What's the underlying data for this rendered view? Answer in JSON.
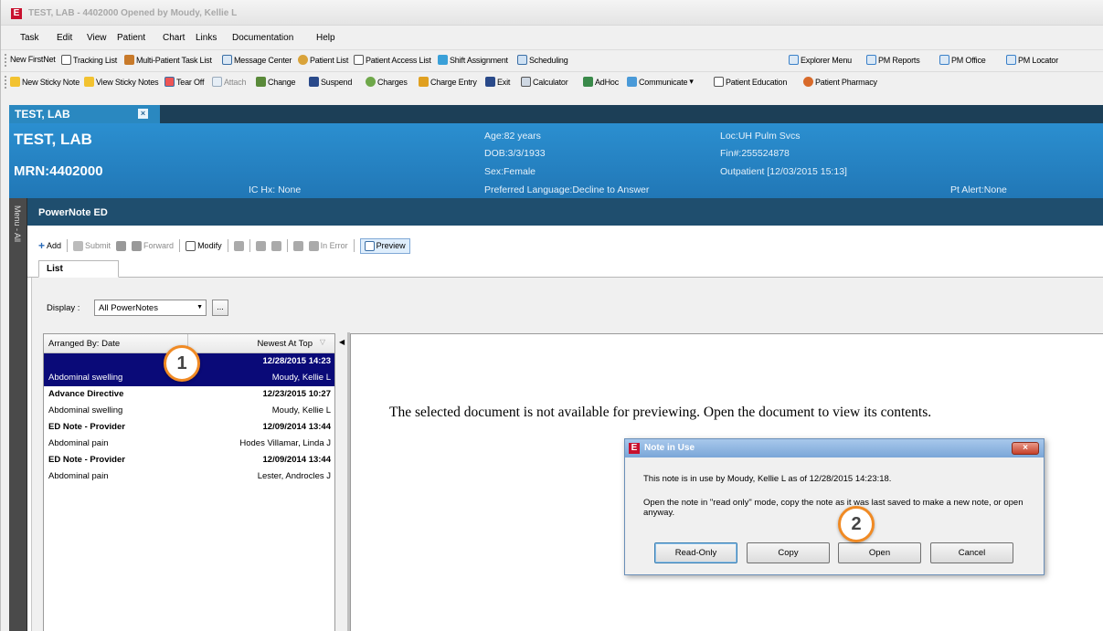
{
  "window": {
    "title": "TEST, LAB - 4402000 Opened by Moudy, Kellie L",
    "logo": "E"
  },
  "menu": [
    "Task",
    "Edit",
    "View",
    "Patient",
    "Chart",
    "Links",
    "Documentation",
    "Help"
  ],
  "toolbar1": [
    {
      "label": "New FirstNet",
      "icon": "none"
    },
    {
      "label": "Tracking List",
      "icon": "tracking-list-icon"
    },
    {
      "label": "Multi-Patient Task List",
      "icon": "multi-patient-icon"
    },
    {
      "label": "Message Center",
      "icon": "message-center-icon"
    },
    {
      "label": "Patient List",
      "icon": "patient-list-icon"
    },
    {
      "label": "Patient Access List",
      "icon": "patient-access-icon"
    },
    {
      "label": "Shift Assignment",
      "icon": "shift-assignment-icon"
    },
    {
      "label": "Scheduling",
      "icon": "scheduling-icon"
    },
    {
      "label": "Explorer Menu",
      "icon": "explorer-menu-icon"
    },
    {
      "label": "PM Reports",
      "icon": "pm-reports-icon"
    },
    {
      "label": "PM Office",
      "icon": "pm-office-icon"
    },
    {
      "label": "PM Locator",
      "icon": "pm-locator-icon"
    }
  ],
  "toolbar2": [
    {
      "label": "New Sticky Note",
      "icon": "sticky-note-icon"
    },
    {
      "label": "View Sticky Notes",
      "icon": "view-sticky-notes-icon"
    },
    {
      "label": "Tear Off",
      "icon": "tear-off-icon"
    },
    {
      "label": "Attach",
      "icon": "attach-icon"
    },
    {
      "label": "Change",
      "icon": "change-icon"
    },
    {
      "label": "Suspend",
      "icon": "suspend-icon"
    },
    {
      "label": "Charges",
      "icon": "charges-icon"
    },
    {
      "label": "Charge Entry",
      "icon": "charge-entry-icon"
    },
    {
      "label": "Exit",
      "icon": "exit-icon"
    },
    {
      "label": "Calculator",
      "icon": "calculator-icon"
    },
    {
      "label": "AdHoc",
      "icon": "adhoc-icon"
    },
    {
      "label": "Communicate",
      "icon": "communicate-icon"
    },
    {
      "label": "Patient Education",
      "icon": "patient-education-icon"
    },
    {
      "label": "Patient Pharmacy",
      "icon": "patient-pharmacy-icon"
    }
  ],
  "patient_tab": {
    "label": "TEST, LAB",
    "close": "×"
  },
  "banner": {
    "name": "TEST, LAB",
    "mrn": "MRN:4402000",
    "ic_hx": "IC Hx: None",
    "age": "Age:82 years",
    "dob": "DOB:3/3/1933",
    "sex": "Sex:Female",
    "language": "Preferred Language:Decline to Answer",
    "loc": "Loc:UH Pulm Svcs",
    "fin": "Fin#:255524878",
    "encounter": "Outpatient [12/03/2015 15:13]",
    "alert": "Pt Alert:None"
  },
  "side_menu": "Menu - All",
  "section_title": "PowerNote ED",
  "actions": {
    "add": "Add",
    "submit": "Submit",
    "forward": "Forward",
    "modify": "Modify",
    "in_error": "In Error",
    "preview": "Preview"
  },
  "list_tab": "List",
  "display": {
    "label": "Display :",
    "value": "All PowerNotes",
    "ellipsis": "..."
  },
  "doc_list": {
    "header_left": "Arranged By: Date",
    "header_right": "Newest At Top",
    "rows": [
      {
        "left": "",
        "right": "12/28/2015 14:23",
        "bold": true,
        "selected": true
      },
      {
        "left": "Abdominal swelling",
        "right": "Moudy, Kellie L",
        "bold": false,
        "selected": true
      },
      {
        "left": "Advance Directive",
        "right": "12/23/2015 10:27",
        "bold": true,
        "selected": false
      },
      {
        "left": "Abdominal swelling",
        "right": "Moudy, Kellie L",
        "bold": false,
        "selected": false
      },
      {
        "left": "ED Note - Provider",
        "right": "12/09/2014 13:44",
        "bold": true,
        "selected": false
      },
      {
        "left": "Abdominal pain",
        "right": "Hodes Villamar, Linda J",
        "bold": false,
        "selected": false
      },
      {
        "left": "ED Note - Provider",
        "right": "12/09/2014 13:44",
        "bold": true,
        "selected": false
      },
      {
        "left": "Abdominal pain",
        "right": "Lester, Androcles J",
        "bold": false,
        "selected": false
      }
    ]
  },
  "preview_message": "The selected document is not available for previewing.  Open the document to view its contents.",
  "dialog": {
    "title": "Note in Use",
    "close": "×",
    "message1": "This note is in use by Moudy, Kellie L as of 12/28/2015 14:23:18.",
    "message2": "Open the note in \"read only\" mode, copy the note as it was last saved to make a new note, or open anyway.",
    "buttons": {
      "read_only": "Read-Only",
      "copy": "Copy",
      "open": "Open",
      "cancel": "Cancel"
    }
  },
  "callouts": [
    "1",
    "2"
  ],
  "colors": {
    "banner": "#2680c2",
    "header_dark": "#1f4e6e",
    "selection": "#0a0a78",
    "callout_ring": "#f08a24"
  }
}
